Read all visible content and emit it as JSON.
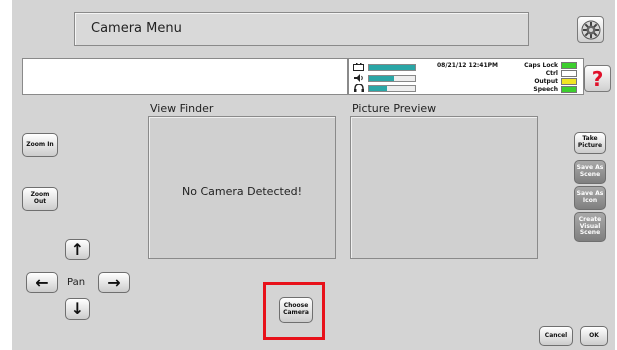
{
  "title": "Camera Menu",
  "status": {
    "datetime": "08/21/12 12:41PM",
    "meters": [
      {
        "icon": "battery-icon",
        "level": 1.0
      },
      {
        "icon": "speaker-icon",
        "level": 0.55
      },
      {
        "icon": "headphones-icon",
        "level": 0.4
      }
    ],
    "indicators": [
      {
        "label": "Caps Lock",
        "color": "#3dcf2e"
      },
      {
        "label": "Ctrl",
        "color": "#ffffff"
      },
      {
        "label": "Output",
        "color": "#f2e524"
      },
      {
        "label": "Speech",
        "color": "#3dcf2e"
      }
    ]
  },
  "icons": {
    "settings": "gear-icon",
    "help": "question-icon",
    "help_color": "#e0112b"
  },
  "view_finder": {
    "label": "View Finder",
    "message": "No Camera Detected!"
  },
  "picture_preview": {
    "label": "Picture Preview"
  },
  "zoom": {
    "in": "Zoom In",
    "out": "Zoom Out"
  },
  "pan": {
    "label": "Pan",
    "up": "↑",
    "down": "↓",
    "left": "←",
    "right": "→"
  },
  "side_buttons": [
    {
      "line1": "Take",
      "line2": "Picture",
      "style": "normal"
    },
    {
      "line1": "Save As",
      "line2": "Scene",
      "style": "gray"
    },
    {
      "line1": "Save As",
      "line2": "Icon",
      "style": "gray"
    },
    {
      "line1": "Create",
      "line2": "Visual",
      "line3": "Scene",
      "style": "gray"
    }
  ],
  "choose_camera": {
    "line1": "Choose",
    "line2": "Camera"
  },
  "highlight_color": "#e8111a",
  "footer": {
    "cancel": "Cancel",
    "ok": "OK"
  }
}
